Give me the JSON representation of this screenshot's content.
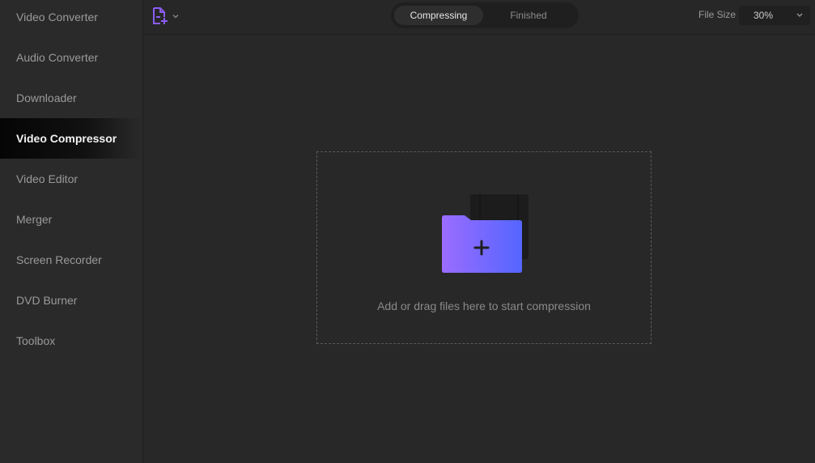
{
  "sidebar": {
    "items": [
      {
        "label": "Video Converter",
        "active": false
      },
      {
        "label": "Audio Converter",
        "active": false
      },
      {
        "label": "Downloader",
        "active": false
      },
      {
        "label": "Video Compressor",
        "active": true
      },
      {
        "label": "Video Editor",
        "active": false
      },
      {
        "label": "Merger",
        "active": false
      },
      {
        "label": "Screen Recorder",
        "active": false
      },
      {
        "label": "DVD Burner",
        "active": false
      },
      {
        "label": "Toolbox",
        "active": false
      }
    ]
  },
  "toolbar": {
    "add_file_icon": "file-add-icon",
    "tabs": [
      {
        "label": "Compressing",
        "active": true
      },
      {
        "label": "Finished",
        "active": false
      }
    ],
    "file_size": {
      "label": "File Size",
      "value": "30%"
    }
  },
  "dropzone": {
    "icon": "folder-add-icon",
    "text": "Add or drag files here to start compression"
  },
  "colors": {
    "accent_start": "#9b6cff",
    "accent_end": "#5466ff",
    "background": "#282828"
  }
}
